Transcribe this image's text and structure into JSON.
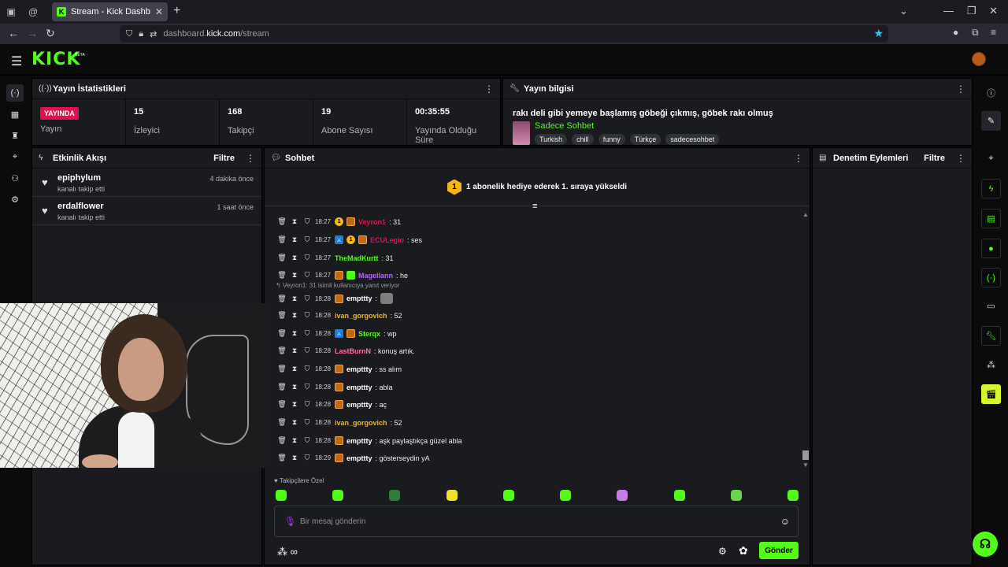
{
  "browser": {
    "tab_title": "Stream - Kick Dashboard",
    "url_prefix": "dashboard.",
    "url_host": "kick.com",
    "url_path": "/stream"
  },
  "app": {
    "logo": "KICK",
    "logo_badge": "BETA"
  },
  "stats": {
    "title": "Yayın İstatistikleri",
    "live_badge": "YAYINDA",
    "items": [
      {
        "value": "",
        "label": "Yayın"
      },
      {
        "value": "15",
        "label": "İzleyici"
      },
      {
        "value": "168",
        "label": "Takipçi"
      },
      {
        "value": "19",
        "label": "Abone Sayısı"
      },
      {
        "value": "00:35:55",
        "label": "Yayında Olduğu Süre"
      }
    ]
  },
  "info": {
    "title": "Yayın bilgisi",
    "stream_title": "rakı deli gibi yemeye başlamış göbeği çıkmış, göbek rakı olmuş",
    "category": "Sadece Sohbet",
    "tags": [
      "Turkish",
      "chill",
      "funny",
      "Türkçe",
      "sadecesohbet"
    ]
  },
  "activity": {
    "title": "Etkinlik Akışı",
    "filter": "Filtre",
    "items": [
      {
        "user": "epiphylum",
        "desc": "kanalı takip etti",
        "time": "4 dakika önce"
      },
      {
        "user": "erdalflower",
        "desc": "kanalı takip etti",
        "time": "1 saat önce"
      }
    ]
  },
  "chat": {
    "title": "Sohbet",
    "pinned_badge": "1",
    "pinned_text": "1 abonelik hediye ederek 1. sıraya yükseldi",
    "reply_note": "Veyron1: 31 isimli kullanıcıya yanıt veriyor",
    "messages": [
      {
        "time": "18:27",
        "user": "Veyron1",
        "color": "#e0114f",
        "text": ": 31",
        "gold": "1"
      },
      {
        "time": "18:27",
        "user": "ECULegio",
        "color": "#e0114f",
        "text": ": ses",
        "gold": "1"
      },
      {
        "time": "18:27",
        "user": "TheMadKurtt",
        "color": "#53fc18",
        "text": ": 31"
      },
      {
        "time": "18:27",
        "user": "Magellann",
        "color": "#b565f2",
        "text": ": he"
      },
      {
        "time": "18:28",
        "user": "empttty",
        "color": "#ffffff",
        "text": ":"
      },
      {
        "time": "18:28",
        "user": "ivan_gorgovich",
        "color": "#f5b51b",
        "text": ": 52"
      },
      {
        "time": "18:28",
        "user": "Sterqx",
        "color": "#53fc18",
        "text": ": wp"
      },
      {
        "time": "18:28",
        "user": "LastBurnN",
        "color": "#ff6fa3",
        "text": ": konuş artık."
      },
      {
        "time": "18:28",
        "user": "empttty",
        "color": "#ffffff",
        "text": ": ss alım"
      },
      {
        "time": "18:28",
        "user": "empttty",
        "color": "#ffffff",
        "text": ": abla"
      },
      {
        "time": "18:28",
        "user": "empttty",
        "color": "#ffffff",
        "text": ": aç"
      },
      {
        "time": "18:28",
        "user": "ivan_gorgovich",
        "color": "#f5b51b",
        "text": ": 52"
      },
      {
        "time": "18:28",
        "user": "empttty",
        "color": "#ffffff",
        "text": ": aşk paylaştıkça güzel abla"
      },
      {
        "time": "18:29",
        "user": "empttty",
        "color": "#ffffff",
        "text": ": gösterseydin yA"
      }
    ],
    "followers_label": "Takipçilere Özel",
    "input_placeholder": "Bir mesaj gönderin",
    "send_label": "Gönder"
  },
  "moderation": {
    "title": "Denetim Eylemleri",
    "filter": "Filtre"
  }
}
